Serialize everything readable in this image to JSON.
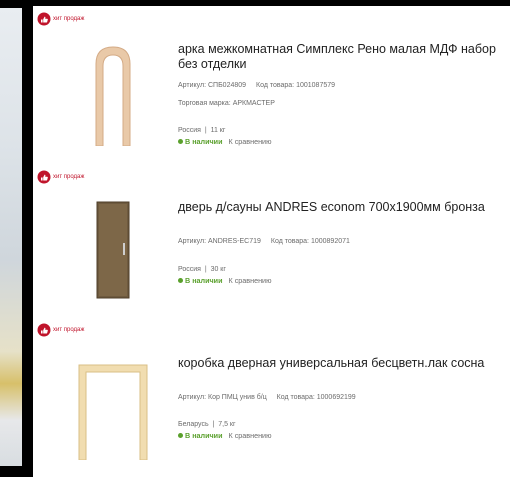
{
  "badge_label": "хит продаж",
  "products": [
    {
      "title": "арка межкомнатная Симплекс Рено малая МДФ набор без отделки",
      "article_label": "Артикул:",
      "article": "СПБ024809",
      "code_label": "Код товара:",
      "code": "1001087579",
      "brand_label": "Торговая марка:",
      "brand": "АРКМАСТЕР",
      "country": "Россия",
      "separator": "|",
      "weight": "11 кг",
      "availability": "В наличии",
      "compare": "К сравнению"
    },
    {
      "title": "дверь д/сауны ANDRES econom 700x1900мм бронза",
      "article_label": "Артикул:",
      "article": "ANDRES-EC719",
      "code_label": "Код товара:",
      "code": "1000892071",
      "country": "Россия",
      "separator": "|",
      "weight": "30 кг",
      "availability": "В наличии",
      "compare": "К сравнению"
    },
    {
      "title": "коробка дверная универсальная бесцветн.лак сосна",
      "article_label": "Артикул:",
      "article": "Кор ПМЦ унив б/ц",
      "code_label": "Код товара:",
      "code": "1000692199",
      "country": "Беларусь",
      "separator": "|",
      "weight": "7,5 кг",
      "availability": "В наличии",
      "compare": "К сравнению"
    }
  ],
  "colors": {
    "badge_red": "#c0142b",
    "availability_green": "#5aa02c",
    "text_dark": "#222222",
    "text_muted": "#6b6b6b"
  }
}
